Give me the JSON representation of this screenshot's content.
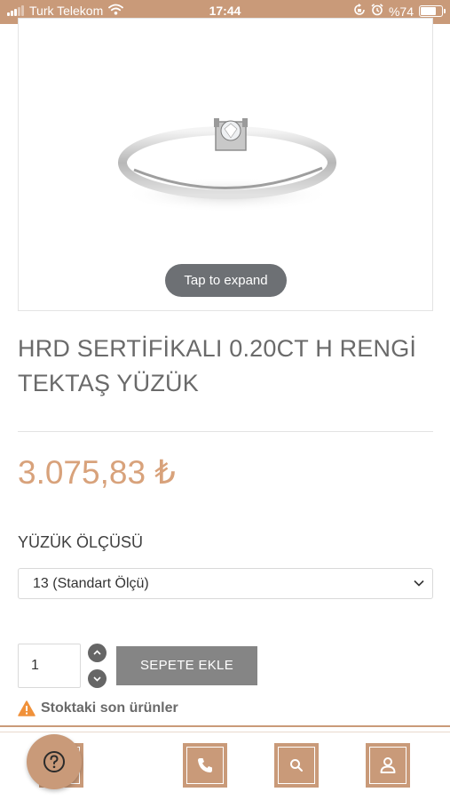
{
  "status_bar": {
    "carrier": "Turk Telekom",
    "time": "17:44",
    "battery": "%74",
    "battery_level": 0.74,
    "icons": [
      "signal-icon",
      "wifi-icon",
      "rotation-lock-icon",
      "alarm-icon",
      "battery-icon"
    ]
  },
  "product": {
    "image_hint": "Tap to expand",
    "title": "HRD SERTİFİKALI 0.20CT H RENGİ TEKTAŞ YÜZÜK",
    "price": "3.075,83 ₺"
  },
  "options": {
    "label": "YÜZÜK ÖLÇÜSÜ",
    "selected": "13 (Standart Ölçü)"
  },
  "cart": {
    "quantity": "1",
    "add_label": "SEPETE EKLE"
  },
  "stock_notice": "Stoktaki son ürünler",
  "bottom_nav": [
    "help-icon",
    "phone-icon",
    "search-icon",
    "user-icon"
  ],
  "colors": {
    "accent": "#c99a79",
    "price": "#d8a27b",
    "button": "#858585",
    "pill": "#6d7074",
    "warning": "#f0913a"
  }
}
